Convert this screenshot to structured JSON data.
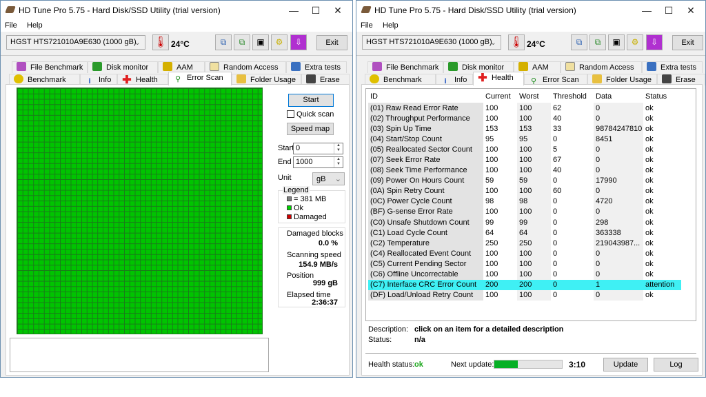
{
  "app_title": "HD Tune Pro 5.75 - Hard Disk/SSD Utility (trial version)",
  "menu": {
    "file": "File",
    "help": "Help"
  },
  "drive": "HGST HTS721010A9E630 (1000 gB)",
  "temperature": "24°C",
  "exit_label": "Exit",
  "tabs_row1": [
    "File Benchmark",
    "Disk monitor",
    "AAM",
    "Random Access",
    "Extra tests"
  ],
  "tabs_row2": [
    "Benchmark",
    "Info",
    "Health",
    "Error Scan",
    "Folder Usage",
    "Erase"
  ],
  "error_scan": {
    "start_button": "Start",
    "quick_scan": "Quick scan",
    "speed_map": "Speed map",
    "start_label": "Start",
    "start_value": "0",
    "end_label": "End",
    "end_value": "1000",
    "unit_label": "Unit",
    "unit_value": "gB",
    "legend_title": "Legend",
    "legend_block": "= 381 MB",
    "legend_ok": "Ok",
    "legend_damaged": "Damaged",
    "damaged_blocks_label": "Damaged blocks",
    "damaged_blocks": "0.0 %",
    "speed_label": "Scanning speed",
    "speed": "154.9 MB/s",
    "position_label": "Position",
    "position": "999 gB",
    "elapsed_label": "Elapsed time",
    "elapsed": "2:36:37"
  },
  "health": {
    "columns": [
      "ID",
      "Current",
      "Worst",
      "Threshold",
      "Data",
      "Status"
    ],
    "rows": [
      [
        "(01) Raw Read Error Rate",
        "100",
        "100",
        "62",
        "0",
        "ok"
      ],
      [
        "(02) Throughput Performance",
        "100",
        "100",
        "40",
        "0",
        "ok"
      ],
      [
        "(03) Spin Up Time",
        "153",
        "153",
        "33",
        "98784247810",
        "ok"
      ],
      [
        "(04) Start/Stop Count",
        "95",
        "95",
        "0",
        "8451",
        "ok"
      ],
      [
        "(05) Reallocated Sector Count",
        "100",
        "100",
        "5",
        "0",
        "ok"
      ],
      [
        "(07) Seek Error Rate",
        "100",
        "100",
        "67",
        "0",
        "ok"
      ],
      [
        "(08) Seek Time Performance",
        "100",
        "100",
        "40",
        "0",
        "ok"
      ],
      [
        "(09) Power On Hours Count",
        "59",
        "59",
        "0",
        "17990",
        "ok"
      ],
      [
        "(0A) Spin Retry Count",
        "100",
        "100",
        "60",
        "0",
        "ok"
      ],
      [
        "(0C) Power Cycle Count",
        "98",
        "98",
        "0",
        "4720",
        "ok"
      ],
      [
        "(BF) G-sense Error Rate",
        "100",
        "100",
        "0",
        "0",
        "ok"
      ],
      [
        "(C0) Unsafe Shutdown Count",
        "99",
        "99",
        "0",
        "298",
        "ok"
      ],
      [
        "(C1) Load Cycle Count",
        "64",
        "64",
        "0",
        "363338",
        "ok"
      ],
      [
        "(C2) Temperature",
        "250",
        "250",
        "0",
        "219043987...",
        "ok"
      ],
      [
        "(C4) Reallocated Event Count",
        "100",
        "100",
        "0",
        "0",
        "ok"
      ],
      [
        "(C5) Current Pending Sector",
        "100",
        "100",
        "0",
        "0",
        "ok"
      ],
      [
        "(C6) Offline Uncorrectable",
        "100",
        "100",
        "0",
        "0",
        "ok"
      ],
      [
        "(C7) Interface CRC Error Count",
        "200",
        "200",
        "0",
        "1",
        "attention"
      ],
      [
        "(DF) Load/Unload Retry Count",
        "100",
        "100",
        "0",
        "0",
        "ok"
      ]
    ],
    "description_label": "Description:",
    "description": "click on an item for a detailed description",
    "status_label": "Status:",
    "status": "n/a",
    "health_status_label": "Health status:",
    "health_status": "ok",
    "next_update_label": "Next update:",
    "next_update_progress_pct": 35,
    "next_update": "3:10",
    "update_button": "Update",
    "log_button": "Log",
    "attention_color": "#3ff0f4",
    "ok_color": "#1fa81f"
  }
}
